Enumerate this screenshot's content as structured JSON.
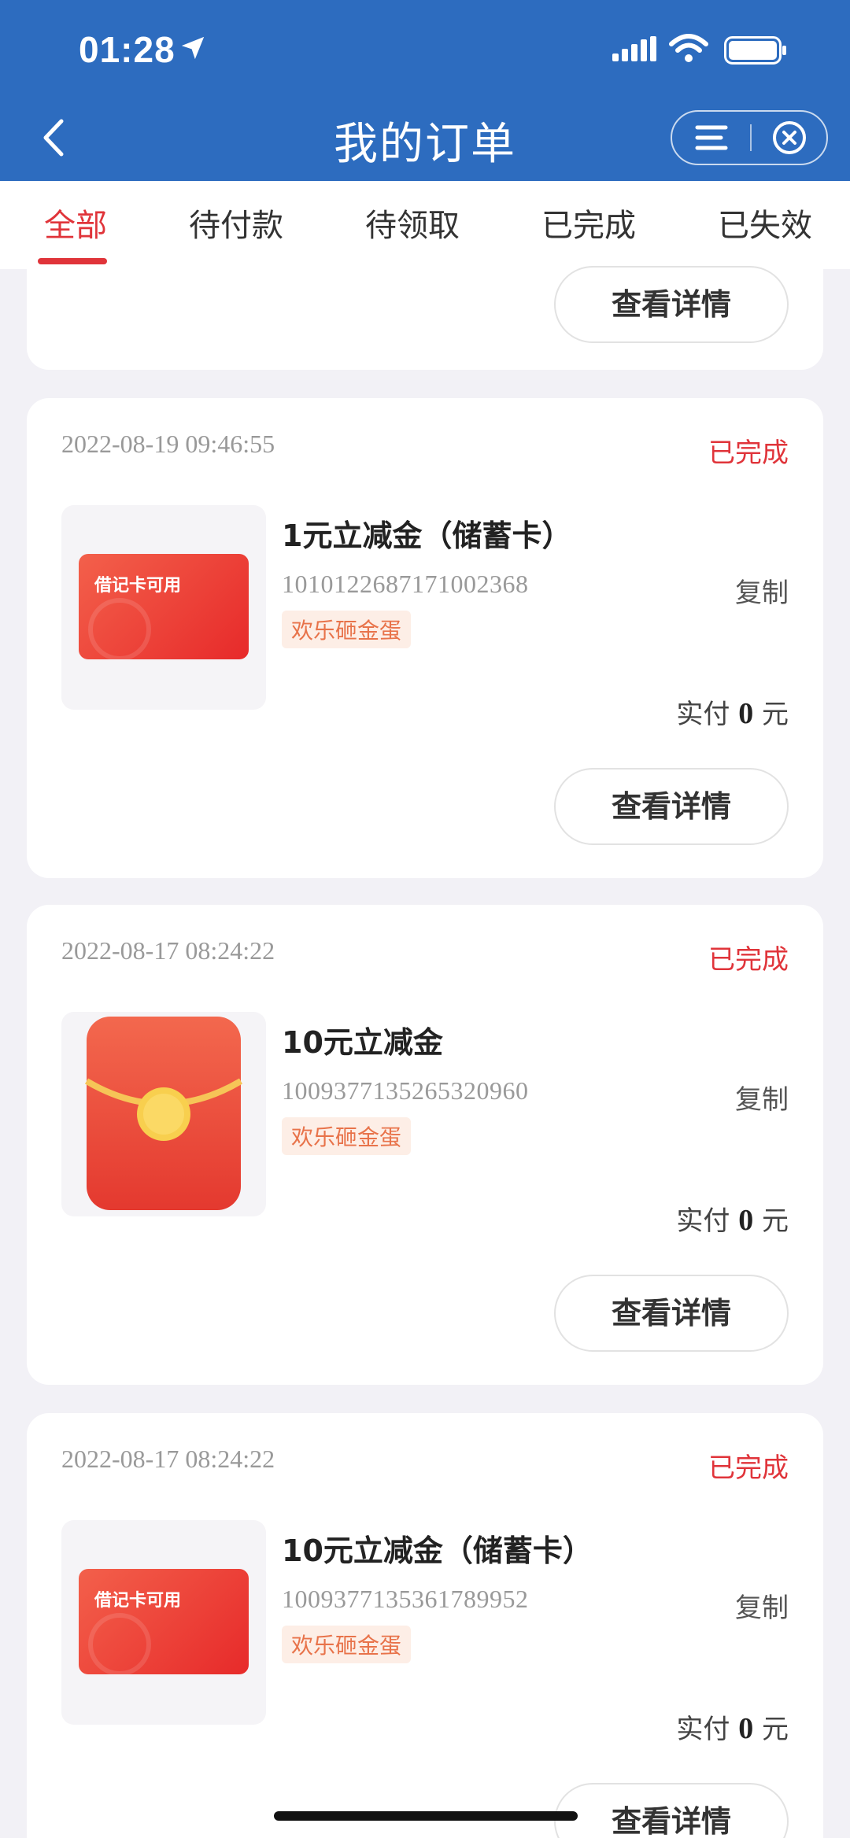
{
  "status_bar": {
    "time": "01:28"
  },
  "header": {
    "title": "我的订单"
  },
  "tabs": [
    {
      "label": "全部",
      "active": true
    },
    {
      "label": "待付款",
      "active": false
    },
    {
      "label": "待领取",
      "active": false
    },
    {
      "label": "已完成",
      "active": false
    },
    {
      "label": "已失效",
      "active": false
    }
  ],
  "top_partial": {
    "detail_label": "查看详情"
  },
  "orders": [
    {
      "timestamp": "2022-08-19 09:46:55",
      "status": "已完成",
      "thumb_label": "借记卡可用",
      "name": "1元立减金（储蓄卡）",
      "order_no": "1010122687171002368",
      "copy_label": "复制",
      "tag": "欢乐砸金蛋",
      "paid_prefix": "实付",
      "paid_amount": "0",
      "paid_unit": "元",
      "detail_label": "查看详情"
    },
    {
      "timestamp": "2022-08-17 08:24:22",
      "status": "已完成",
      "name": "10元立减金",
      "order_no": "1009377135265320960",
      "copy_label": "复制",
      "tag": "欢乐砸金蛋",
      "paid_prefix": "实付",
      "paid_amount": "0",
      "paid_unit": "元",
      "detail_label": "查看详情"
    },
    {
      "timestamp": "2022-08-17 08:24:22",
      "status": "已完成",
      "thumb_label": "借记卡可用",
      "name": "10元立减金（储蓄卡）",
      "order_no": "1009377135361789952",
      "copy_label": "复制",
      "tag": "欢乐砸金蛋",
      "paid_prefix": "实付",
      "paid_amount": "0",
      "paid_unit": "元",
      "detail_label": "查看详情"
    }
  ],
  "colors": {
    "header_bg": "#2d6cbf",
    "accent_red": "#e0343a",
    "tag_text": "#e8734a",
    "tag_bg": "#fdeee6"
  }
}
